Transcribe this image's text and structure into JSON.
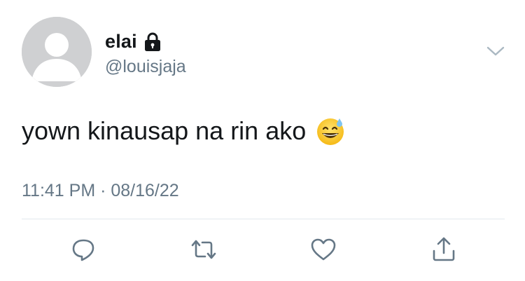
{
  "user": {
    "display_name": "elai",
    "handle": "@louisjaja",
    "protected_icon": "lock-icon",
    "avatar": "default-avatar"
  },
  "tweet": {
    "text": "yown kinausap na rin ako",
    "emoji": "grinning-face-with-sweat",
    "timestamp": "11:41 PM · 08/16/22"
  },
  "menu_icon": "chevron-down-icon",
  "actions": [
    {
      "name": "reply",
      "icon": "comment-icon"
    },
    {
      "name": "retweet",
      "icon": "retweet-icon"
    },
    {
      "name": "like",
      "icon": "heart-icon"
    },
    {
      "name": "share",
      "icon": "share-icon"
    }
  ],
  "colors": {
    "primary_text": "#14171a",
    "secondary_text": "#657786",
    "divider": "#e1e8ed",
    "avatar_bg": "#cfd0d2",
    "icon": "#657786"
  }
}
